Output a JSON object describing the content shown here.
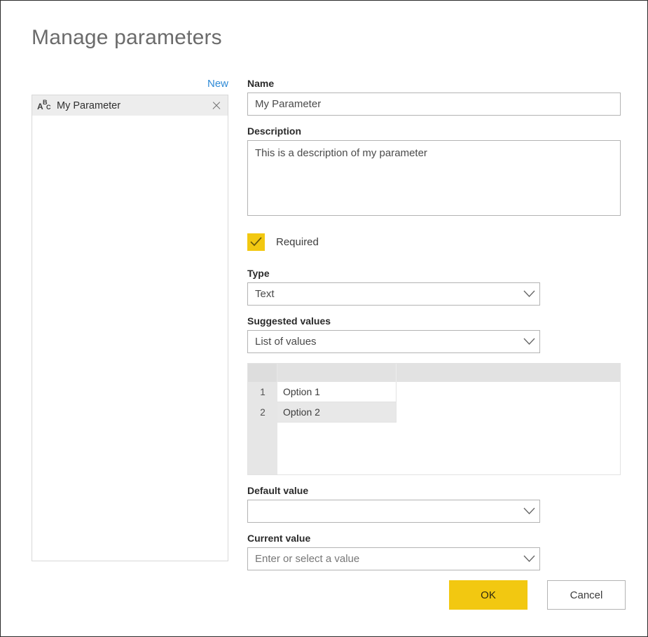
{
  "dialog": {
    "title": "Manage parameters"
  },
  "left_panel": {
    "new_label": "New",
    "items": [
      {
        "icon": "abc-text-type-icon",
        "icon_letters": {
          "a": "A",
          "b": "B",
          "c": "C"
        },
        "label": "My Parameter",
        "close_icon": "close-icon"
      }
    ]
  },
  "form": {
    "name": {
      "label": "Name",
      "value": "My Parameter",
      "placeholder": ""
    },
    "description": {
      "label": "Description",
      "value": "This is a description of my parameter",
      "placeholder": ""
    },
    "required": {
      "label": "Required",
      "checked": true,
      "accent_color": "#F2C811",
      "check_icon": "check-icon"
    },
    "type": {
      "label": "Type",
      "value": "Text",
      "chevron_icon": "chevron-down-icon"
    },
    "suggested_values": {
      "label": "Suggested values",
      "value": "List of values",
      "chevron_icon": "chevron-down-icon"
    },
    "values_grid": {
      "rows": [
        {
          "index": "1",
          "value": "Option 1"
        },
        {
          "index": "2",
          "value": "Option 2"
        }
      ]
    },
    "default_value": {
      "label": "Default value",
      "value": "",
      "chevron_icon": "chevron-down-icon"
    },
    "current_value": {
      "label": "Current value",
      "value": "",
      "placeholder": "Enter or select a value",
      "chevron_icon": "chevron-down-icon"
    }
  },
  "footer": {
    "ok_label": "OK",
    "cancel_label": "Cancel",
    "primary_color": "#F2C811"
  }
}
